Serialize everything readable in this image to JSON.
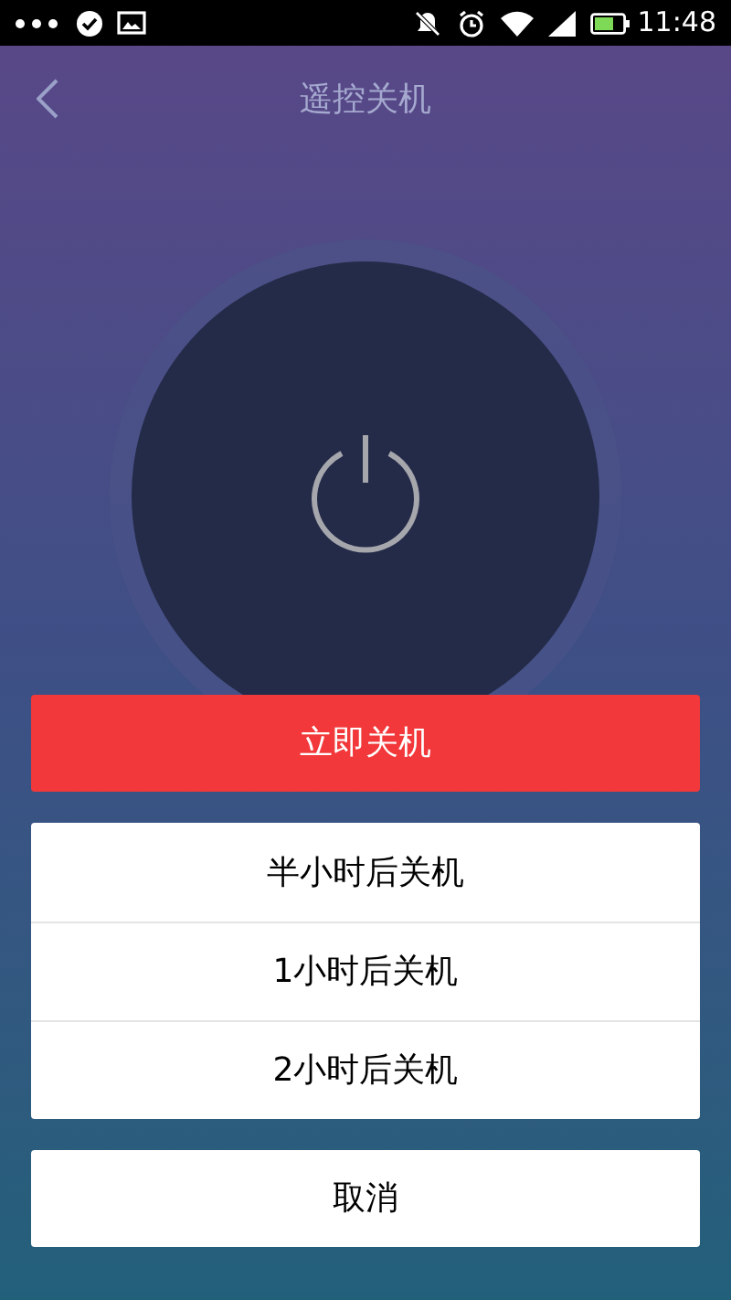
{
  "status_bar": {
    "time": "11:48"
  },
  "header": {
    "title": "遥控关机"
  },
  "primary_action": {
    "label": "立即关机"
  },
  "options": [
    {
      "label": "半小时后关机"
    },
    {
      "label": "1小时后关机"
    },
    {
      "label": "2小时后关机"
    }
  ],
  "cancel": {
    "label": "取消"
  }
}
